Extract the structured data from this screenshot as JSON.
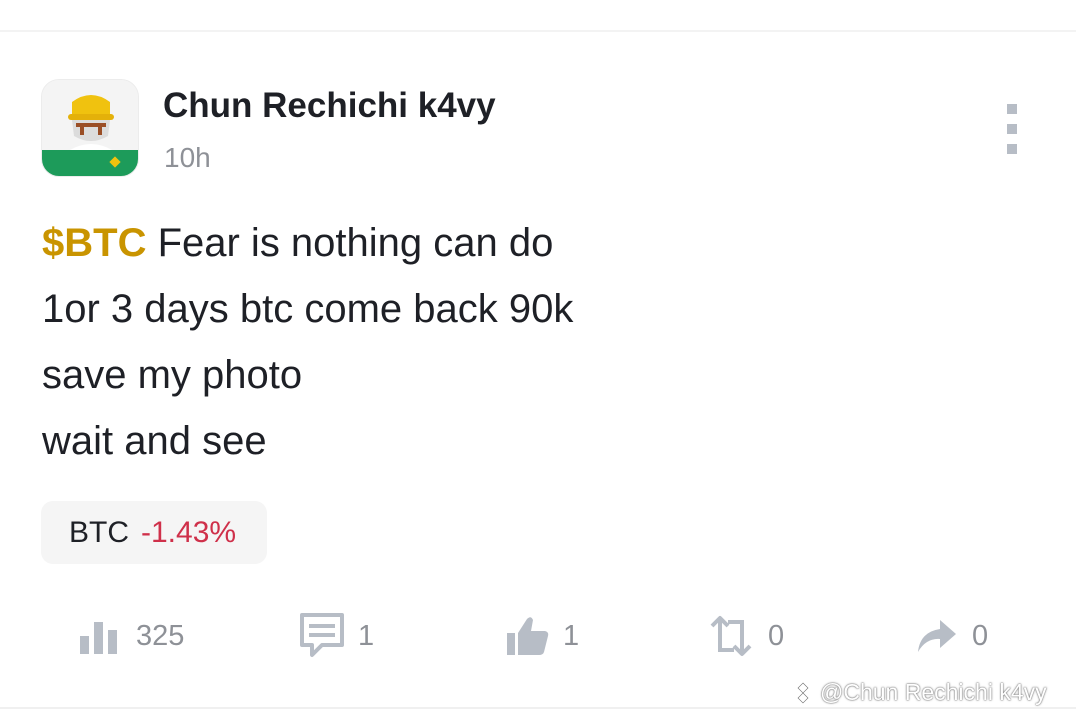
{
  "post": {
    "author": "Chun Rechichi k4vy",
    "time": "10h",
    "ticker": "$BTC",
    "line1_rest": " Fear is nothing can do",
    "line2": "1or 3 days btc come back 90k",
    "line3": "save my photo",
    "line4": "wait and see"
  },
  "chip": {
    "symbol": "BTC",
    "change": "-1.43%",
    "change_color": "#cf304a"
  },
  "actions": {
    "views": "325",
    "comments": "1",
    "likes": "1",
    "reposts": "0",
    "shares": "0"
  },
  "watermark": "@Chun Rechichi k4vy",
  "colors": {
    "ticker": "#c99400",
    "icon_gray": "#b7bdc6",
    "muted_text": "#8e9197"
  },
  "icons": [
    "more-vertical-icon",
    "bar-chart-icon",
    "comment-icon",
    "thumbs-up-icon",
    "repost-icon",
    "share-icon",
    "binance-logo-icon"
  ]
}
